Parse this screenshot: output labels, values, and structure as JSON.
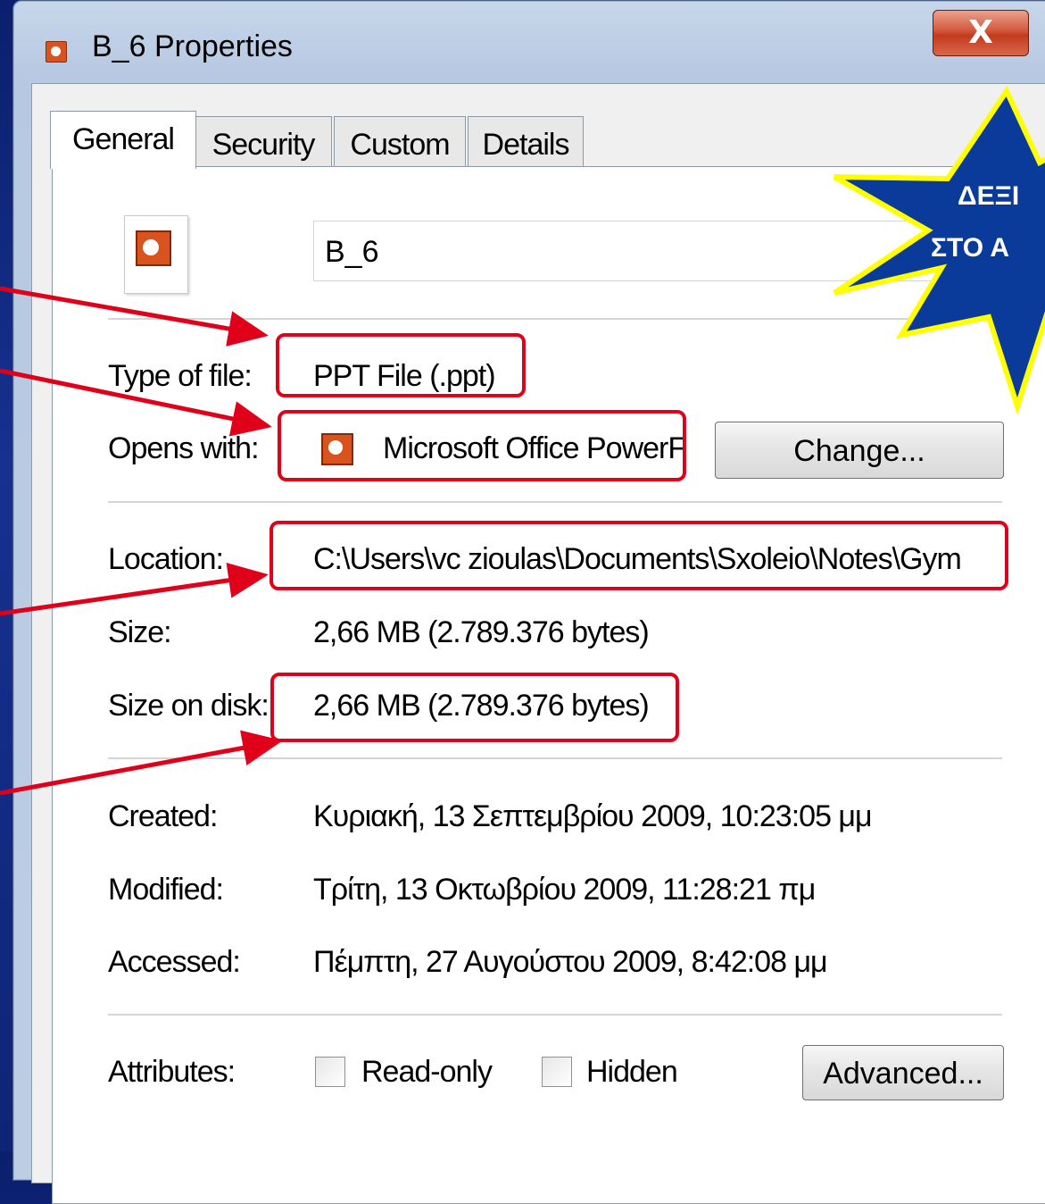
{
  "window": {
    "title": "B_6 Properties",
    "close_label": "X"
  },
  "tabs": [
    {
      "label": "General",
      "active": true
    },
    {
      "label": "Security",
      "active": false
    },
    {
      "label": "Custom",
      "active": false
    },
    {
      "label": "Details",
      "active": false
    }
  ],
  "general": {
    "file_name": "B_6",
    "type_label": "Type of file:",
    "type_value": "PPT File (.ppt)",
    "opens_label": "Opens with:",
    "opens_value": "Microsoft Office PowerF",
    "change_button": "Change...",
    "location_label": "Location:",
    "location_value": "C:\\Users\\vc zioulas\\Documents\\Sxoleio\\Notes\\Gym",
    "size_label": "Size:",
    "size_value": "2,66 MB (2.789.376 bytes)",
    "size_on_disk_label": "Size on disk:",
    "size_on_disk_value": "2,66 MB (2.789.376 bytes)",
    "created_label": "Created:",
    "created_value": "Κυριακή, 13 Σεπτεμβρίου 2009, 10:23:05 μμ",
    "modified_label": "Modified:",
    "modified_value": "Τρίτη, 13 Οκτωβρίου 2009, 11:28:21 πμ",
    "accessed_label": "Accessed:",
    "accessed_value": "Πέμπτη, 27 Αυγούστου 2009, 8:42:08 μμ",
    "attributes_label": "Attributes:",
    "readonly_label": "Read-only",
    "hidden_label": "Hidden",
    "advanced_button": "Advanced..."
  },
  "callout": {
    "line1": "ΔΕΞΙ",
    "line2": "ΣΤΟ Α"
  },
  "colors": {
    "highlight": "#e00019",
    "star_fill": "#0a3a9a",
    "star_outline": "#ffff00"
  }
}
